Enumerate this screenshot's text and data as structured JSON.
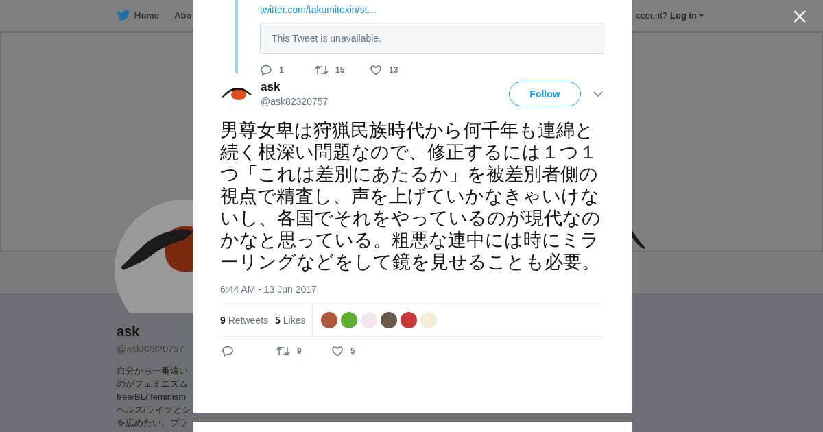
{
  "nav": {
    "home": "Home",
    "about": "Abo",
    "account_prompt": "ccount?",
    "login": "Log in"
  },
  "profile": {
    "name": "ask",
    "handle": "@ask82320757",
    "bio_lines": [
      "自分から一番遠い",
      "のがフェミニズム",
      "free/BL/ feminism",
      "ヘルス/ライツとシ",
      "を広めたい。プラ"
    ]
  },
  "quoted": {
    "link": "twitter.com/takumitoxin/st…",
    "unavailable": "This Tweet is unavailable.",
    "replies": "1",
    "retweets": "15",
    "likes": "13"
  },
  "tweet": {
    "name": "ask",
    "handle": "@ask82320757",
    "follow": "Follow",
    "text": "男尊女卑は狩猟民族時代から何千年も連綿と続く根深い問題なので、修正するには１つ１つ「これは差別にあたるか」を被差別者側の視点で精査し、声を上げていかなきゃいけないし、各国でそれをやっているのが現代なのかなと思っている。粗悪な連中には時にミラーリングなどをして鏡を見せることも必要。",
    "time": "6:44 AM - 13 Jun 2017",
    "stats": [
      "**9** Retweets",
      "**5** Likes"
    ],
    "likers": [
      {
        "color": "#b05a3c"
      },
      {
        "color": "#5cb030"
      },
      {
        "color": "#f2e6ee"
      },
      {
        "color": "#6a5a4a"
      },
      {
        "color": "#c8373a"
      },
      {
        "color": "#f3eed8"
      }
    ],
    "retweets": "9",
    "likes": "5"
  }
}
